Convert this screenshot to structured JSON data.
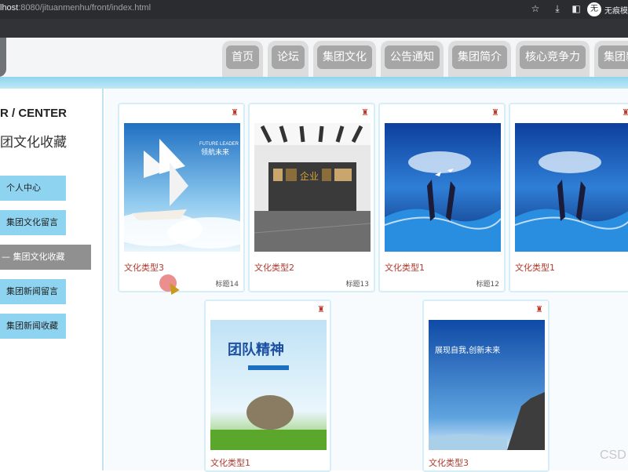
{
  "browser": {
    "url_host": "lhost",
    "url_path": ":8080/jituanmenhu/front/index.html",
    "profile_name": "无痕模式",
    "profile_initial": "无"
  },
  "nav": {
    "items": [
      "首页",
      "论坛",
      "集团文化",
      "公告通知",
      "集团简介",
      "核心竞争力",
      "集团新闻"
    ]
  },
  "sidebar": {
    "title_en": "R / CENTER",
    "title_cn": "团文化收藏",
    "items": [
      {
        "label": "个人中心",
        "active": false
      },
      {
        "label": "集团文化留言",
        "active": false
      },
      {
        "label": "—  集团文化收藏",
        "active": true
      },
      {
        "label": "集团新闻留言",
        "active": false
      },
      {
        "label": "集团新闻收藏",
        "active": false
      }
    ]
  },
  "cards": [
    {
      "type": "文化类型3",
      "label": "标题14",
      "image": "sailing-ship-poster"
    },
    {
      "type": "文化类型2",
      "label": "标题13",
      "image": "office-culture-wall"
    },
    {
      "type": "文化类型1",
      "label": "标题12",
      "image": "hands-wave-poster"
    },
    {
      "type": "文化类型1",
      "label": "",
      "image": "hands-wave-poster"
    },
    {
      "type": "文化类型1",
      "label": "",
      "image": "team-spirit-poster"
    },
    {
      "type": "文化类型3",
      "label": "",
      "image": "show-yourself-poster"
    }
  ],
  "posters": {
    "future_leader": "FUTURE LEADER",
    "future_cn": "领航未来",
    "culture_sign": "企业",
    "team_spirit": "团队精神",
    "show_self": "展现自我,创新未来"
  },
  "fav_icon": "collect-icon",
  "watermark": "CSD",
  "colors": {
    "nav_bg": "#a6a6a6",
    "sidebar_item": "#8ed4f1",
    "sidebar_active": "#909090",
    "type_text": "#b03a2e"
  }
}
